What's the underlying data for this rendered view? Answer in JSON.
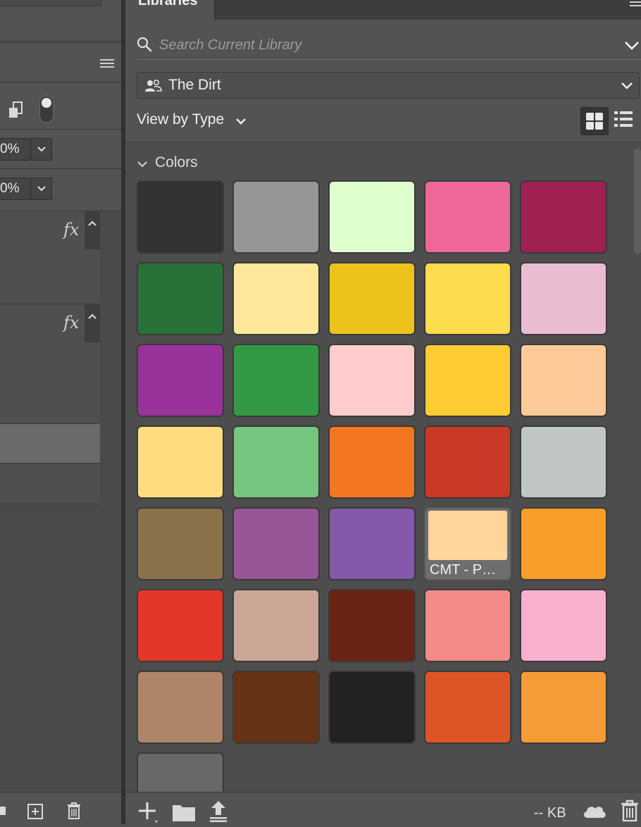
{
  "libraries_panel": {
    "tab_title": "Libraries",
    "search": {
      "placeholder": "Search Current Library",
      "value": ""
    },
    "library_name": "The Dirt",
    "view_by_label": "View by Type",
    "colors_section_title": "Colors",
    "swatches": [
      {
        "color": "#323232"
      },
      {
        "color": "#969696"
      },
      {
        "color": "#dfffcc"
      },
      {
        "color": "#ef6699"
      },
      {
        "color": "#9e2152"
      },
      {
        "color": "#2a7139"
      },
      {
        "color": "#ffe899"
      },
      {
        "color": "#ecc31a"
      },
      {
        "color": "#fcdb4c"
      },
      {
        "color": "#e9bcd1"
      },
      {
        "color": "#99329a"
      },
      {
        "color": "#339944"
      },
      {
        "color": "#ffcccc"
      },
      {
        "color": "#ffcc33"
      },
      {
        "color": "#fdcb99"
      },
      {
        "color": "#ffdd7f"
      },
      {
        "color": "#76c680"
      },
      {
        "color": "#f47620"
      },
      {
        "color": "#ca3827"
      },
      {
        "color": "#c0c5c6"
      },
      {
        "color": "#89724a"
      },
      {
        "color": "#955596"
      },
      {
        "color": "#8159a8"
      },
      {
        "color": "#ffd699",
        "label": "CMT - P…"
      },
      {
        "color": "#f99d27"
      },
      {
        "color": "#e43727"
      },
      {
        "color": "#cca695"
      },
      {
        "color": "#6b2414"
      },
      {
        "color": "#f58b87"
      },
      {
        "color": "#f8b0cf"
      },
      {
        "color": "#b08468"
      },
      {
        "color": "#663314"
      },
      {
        "color": "#242122"
      },
      {
        "color": "#df5426"
      },
      {
        "color": "#f59b37"
      },
      {
        "color": "#686868"
      }
    ],
    "storage": "-- KB"
  },
  "layers_panel": {
    "opacity_value": "0%",
    "fill_value": "0%",
    "fx_label": "fx"
  },
  "theme": {
    "panel_bg": "#535353",
    "content_bg": "#4d4d4d",
    "text_color": "#e8e8e8"
  }
}
